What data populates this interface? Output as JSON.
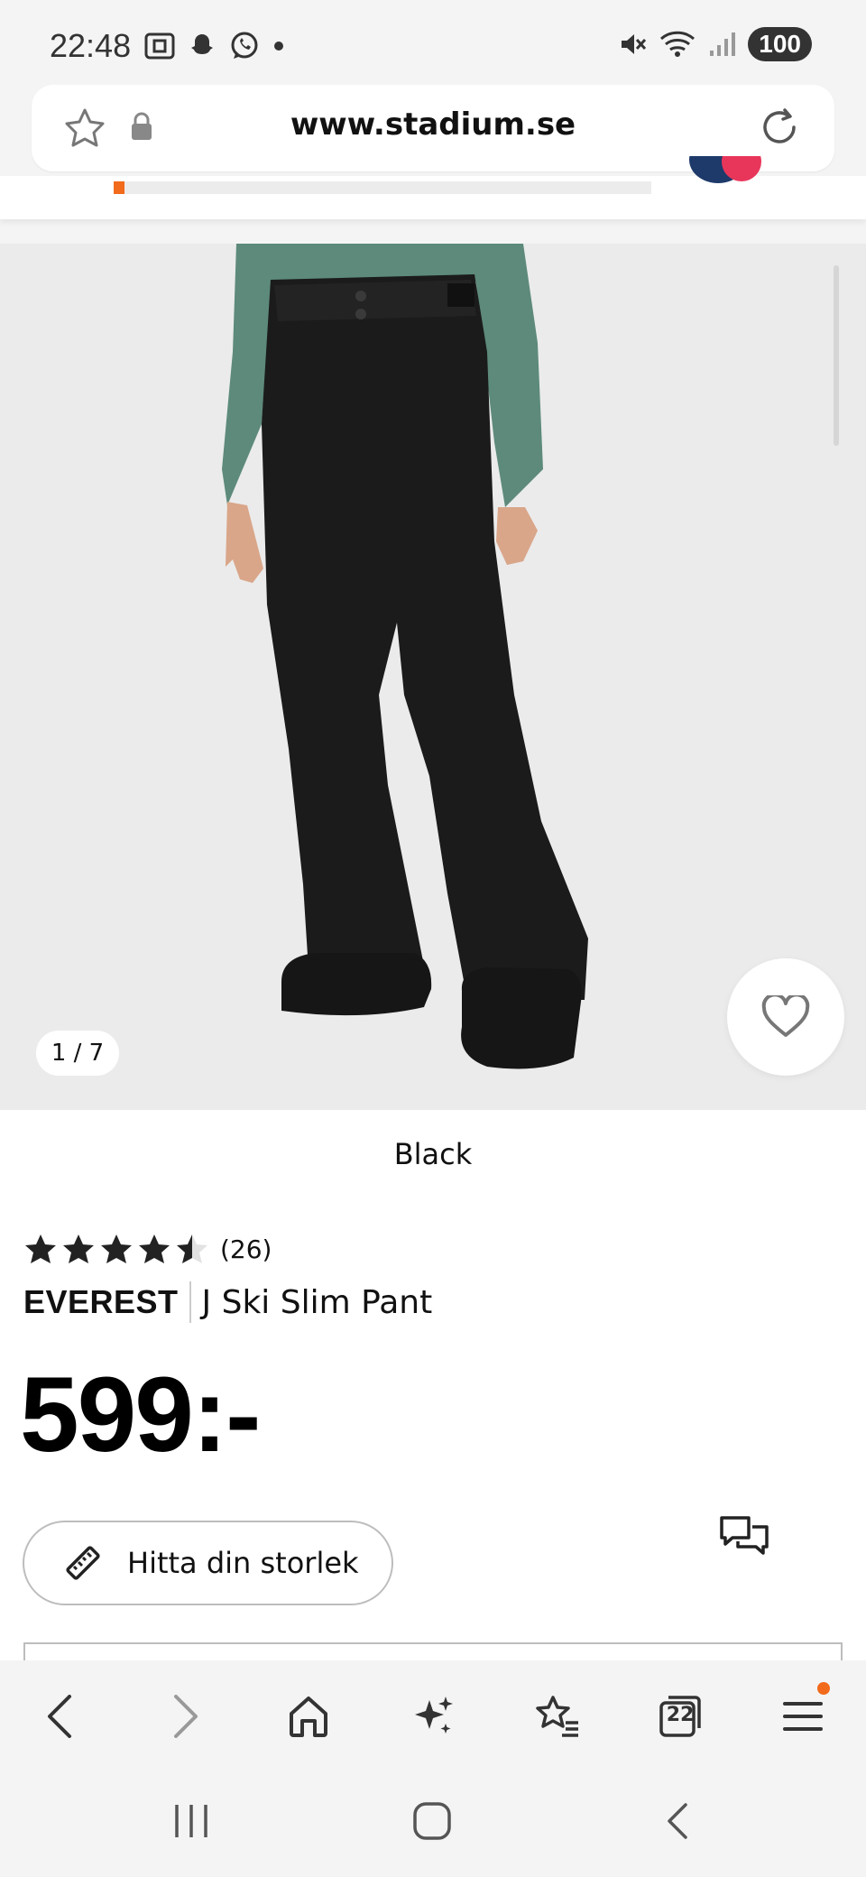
{
  "status_bar": {
    "time": "22:48",
    "battery": "100",
    "icons": [
      "screenshot-icon",
      "snapchat-icon",
      "whatsapp-icon",
      "dot-icon",
      "mute-icon",
      "wifi-icon",
      "signal-icon"
    ]
  },
  "browser": {
    "url": "www.stadium.se",
    "tabs_count": "22"
  },
  "page": {
    "progress_fraction": 0.02,
    "image_counter": "1 / 7",
    "color_name": "Black",
    "rating": {
      "value": 4.5,
      "max": 5,
      "count_label": "(26)"
    },
    "brand": "EVEREST",
    "product_name": "J Ski Slim Pant",
    "price": "599:-",
    "size_button_label": "Hitta din storlek"
  },
  "colors": {
    "accent": "#f26a1b",
    "background": "#f4f4f4"
  }
}
